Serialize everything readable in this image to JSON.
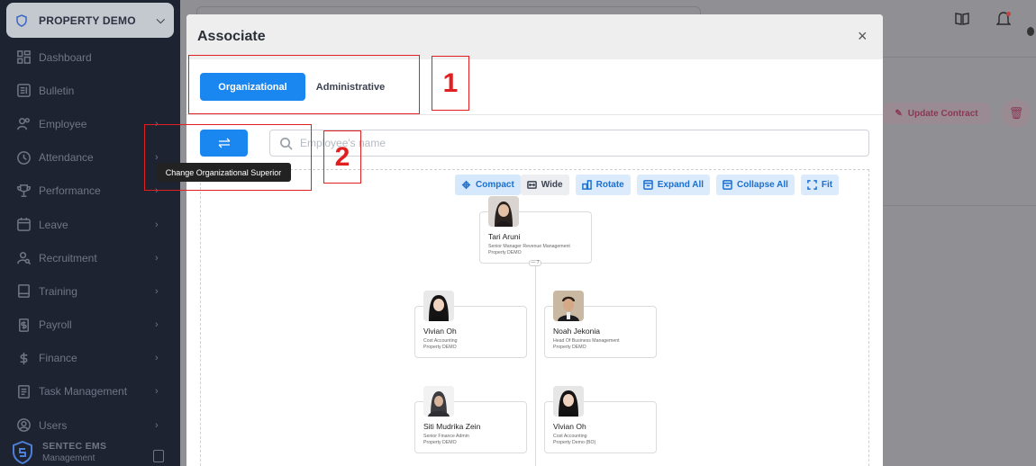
{
  "sidebar": {
    "property_selector": "PROPERTY DEMO",
    "items": [
      {
        "label": "Dashboard",
        "icon": "dashboard-icon",
        "has_submenu": false
      },
      {
        "label": "Bulletin",
        "icon": "bulletin-icon",
        "has_submenu": false
      },
      {
        "label": "Employee",
        "icon": "employee-icon",
        "has_submenu": true
      },
      {
        "label": "Attendance",
        "icon": "attendance-icon",
        "has_submenu": true
      },
      {
        "label": "Performance",
        "icon": "trophy-icon",
        "has_submenu": true
      },
      {
        "label": "Leave",
        "icon": "calendar-icon",
        "has_submenu": true
      },
      {
        "label": "Recruitment",
        "icon": "recruitment-icon",
        "has_submenu": true
      },
      {
        "label": "Training",
        "icon": "training-icon",
        "has_submenu": true
      },
      {
        "label": "Payroll",
        "icon": "payroll-icon",
        "has_submenu": true
      },
      {
        "label": "Finance",
        "icon": "dollar-icon",
        "has_submenu": true
      },
      {
        "label": "Task Management",
        "icon": "task-icon",
        "has_submenu": true
      },
      {
        "label": "Users",
        "icon": "users-icon",
        "has_submenu": true
      }
    ],
    "brand": {
      "name": "SENTEC EMS",
      "subtitle": "Management"
    }
  },
  "background": {
    "update_contract_label": "Update Contract",
    "accent_color": "#d63384"
  },
  "modal": {
    "title": "Associate",
    "close_label": "×",
    "tabs": [
      {
        "label": "Organizational",
        "active": true
      },
      {
        "label": "Administrative",
        "active": false
      }
    ],
    "search_placeholder": "Employee's name",
    "tooltip": "Change Organizational Superior",
    "toolbar": [
      {
        "label": "Compact",
        "icon": "move-icon",
        "active": true
      },
      {
        "label": "Wide",
        "icon": "expand-horizontal-icon",
        "active": false
      },
      {
        "label": "Rotate",
        "icon": "rotate-icon",
        "active": false
      },
      {
        "label": "Expand All",
        "icon": "expand-all-icon",
        "active": false
      },
      {
        "label": "Collapse All",
        "icon": "collapse-all-icon",
        "active": false
      },
      {
        "label": "Fit",
        "icon": "fit-icon",
        "active": false
      }
    ],
    "nodes": [
      {
        "name": "Tari Aruni",
        "position": "Senior Manager Revenue Management",
        "property": "Property DEMO"
      },
      {
        "name": "Vivian Oh",
        "position": "Cost Accounting",
        "property": "Property DEMO"
      },
      {
        "name": "Noah Jekonia",
        "position": "Head Of Business Management",
        "property": "Property DEMO"
      },
      {
        "name": "Siti Mudrika Zein",
        "position": "Senior Finance Admin",
        "property": "Property DEMO"
      },
      {
        "name": "Vivian Oh",
        "position": "Cost Accounting",
        "property": "Property Demo (BO)"
      }
    ],
    "collapse_indicator": "— 7"
  },
  "annotations": [
    {
      "label": "1"
    },
    {
      "label": "2"
    }
  ],
  "colors": {
    "primary": "#1a86f0",
    "sidebar_bg": "#1d2331",
    "annotation_red": "#e02020"
  }
}
